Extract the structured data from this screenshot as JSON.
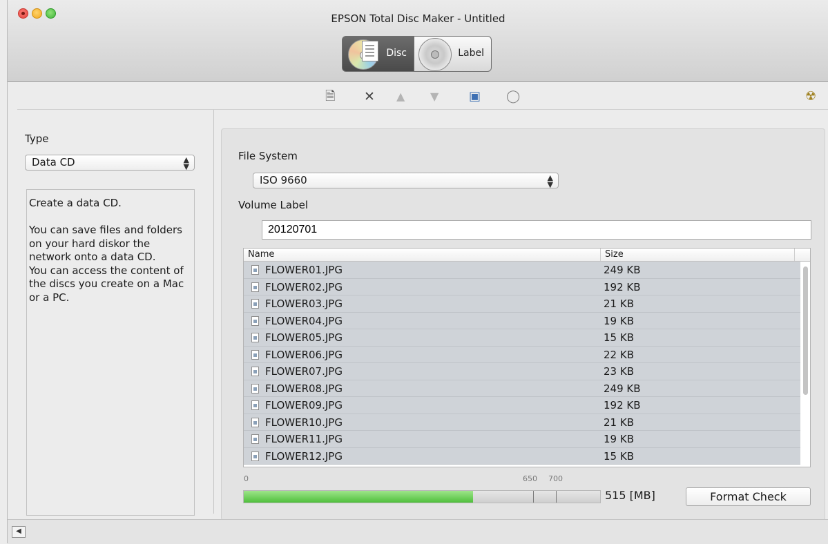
{
  "window": {
    "title": "EPSON Total Disc Maker - Untitled"
  },
  "modes": {
    "disc": "Disc",
    "label": "Label"
  },
  "toolbar_icons": [
    "add-file-icon",
    "delete-icon",
    "move-up-icon",
    "move-down-icon",
    "finder-icon",
    "disc-info-icon",
    "burn-icon"
  ],
  "left": {
    "type_label": "Type",
    "type_value": "Data CD",
    "description": "Create a data CD.\n\nYou can save files and folders on your hard diskor the network onto a data CD.\nYou can access the content of the discs you create on a Mac or a PC."
  },
  "right": {
    "fs_label": "File System",
    "fs_value": "ISO 9660",
    "vol_label": "Volume Label",
    "vol_value": "20120701",
    "columns": {
      "name": "Name",
      "size": "Size"
    },
    "files": [
      {
        "name": "FLOWER01.JPG",
        "size": "249 KB"
      },
      {
        "name": "FLOWER02.JPG",
        "size": "192 KB"
      },
      {
        "name": "FLOWER03.JPG",
        "size": "21 KB"
      },
      {
        "name": "FLOWER04.JPG",
        "size": "19 KB"
      },
      {
        "name": "FLOWER05.JPG",
        "size": "15 KB"
      },
      {
        "name": "FLOWER06.JPG",
        "size": "22 KB"
      },
      {
        "name": "FLOWER07.JPG",
        "size": "23 KB"
      },
      {
        "name": "FLOWER08.JPG",
        "size": "249 KB"
      },
      {
        "name": "FLOWER09.JPG",
        "size": "192 KB"
      },
      {
        "name": "FLOWER10.JPG",
        "size": "21 KB"
      },
      {
        "name": "FLOWER11.JPG",
        "size": "19 KB"
      },
      {
        "name": "FLOWER12.JPG",
        "size": "15 KB"
      }
    ],
    "capacity": {
      "tick_start": "0",
      "tick_650": "650",
      "tick_700": "700",
      "used_mb": 515,
      "max_mb": 800,
      "used_text": "515 [MB]"
    },
    "format_check": "Format Check"
  },
  "colors": {
    "progress": "#5cc449",
    "selected_row": "#cfd3d8"
  }
}
